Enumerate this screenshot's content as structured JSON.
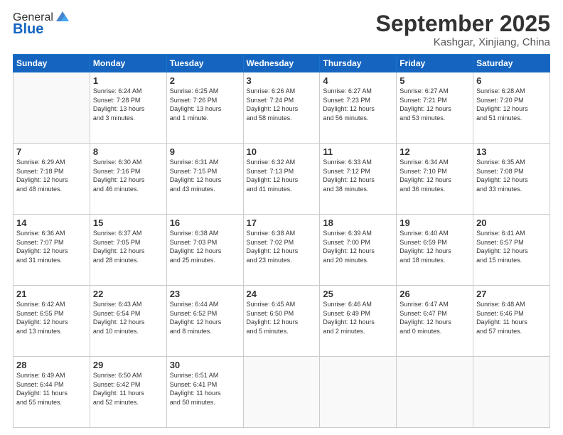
{
  "header": {
    "logo_general": "General",
    "logo_blue": "Blue",
    "month_title": "September 2025",
    "location": "Kashgar, Xinjiang, China"
  },
  "weekdays": [
    "Sunday",
    "Monday",
    "Tuesday",
    "Wednesday",
    "Thursday",
    "Friday",
    "Saturday"
  ],
  "weeks": [
    [
      {
        "day": "",
        "info": ""
      },
      {
        "day": "1",
        "info": "Sunrise: 6:24 AM\nSunset: 7:28 PM\nDaylight: 13 hours\nand 3 minutes."
      },
      {
        "day": "2",
        "info": "Sunrise: 6:25 AM\nSunset: 7:26 PM\nDaylight: 13 hours\nand 1 minute."
      },
      {
        "day": "3",
        "info": "Sunrise: 6:26 AM\nSunset: 7:24 PM\nDaylight: 12 hours\nand 58 minutes."
      },
      {
        "day": "4",
        "info": "Sunrise: 6:27 AM\nSunset: 7:23 PM\nDaylight: 12 hours\nand 56 minutes."
      },
      {
        "day": "5",
        "info": "Sunrise: 6:27 AM\nSunset: 7:21 PM\nDaylight: 12 hours\nand 53 minutes."
      },
      {
        "day": "6",
        "info": "Sunrise: 6:28 AM\nSunset: 7:20 PM\nDaylight: 12 hours\nand 51 minutes."
      }
    ],
    [
      {
        "day": "7",
        "info": "Sunrise: 6:29 AM\nSunset: 7:18 PM\nDaylight: 12 hours\nand 48 minutes."
      },
      {
        "day": "8",
        "info": "Sunrise: 6:30 AM\nSunset: 7:16 PM\nDaylight: 12 hours\nand 46 minutes."
      },
      {
        "day": "9",
        "info": "Sunrise: 6:31 AM\nSunset: 7:15 PM\nDaylight: 12 hours\nand 43 minutes."
      },
      {
        "day": "10",
        "info": "Sunrise: 6:32 AM\nSunset: 7:13 PM\nDaylight: 12 hours\nand 41 minutes."
      },
      {
        "day": "11",
        "info": "Sunrise: 6:33 AM\nSunset: 7:12 PM\nDaylight: 12 hours\nand 38 minutes."
      },
      {
        "day": "12",
        "info": "Sunrise: 6:34 AM\nSunset: 7:10 PM\nDaylight: 12 hours\nand 36 minutes."
      },
      {
        "day": "13",
        "info": "Sunrise: 6:35 AM\nSunset: 7:08 PM\nDaylight: 12 hours\nand 33 minutes."
      }
    ],
    [
      {
        "day": "14",
        "info": "Sunrise: 6:36 AM\nSunset: 7:07 PM\nDaylight: 12 hours\nand 31 minutes."
      },
      {
        "day": "15",
        "info": "Sunrise: 6:37 AM\nSunset: 7:05 PM\nDaylight: 12 hours\nand 28 minutes."
      },
      {
        "day": "16",
        "info": "Sunrise: 6:38 AM\nSunset: 7:03 PM\nDaylight: 12 hours\nand 25 minutes."
      },
      {
        "day": "17",
        "info": "Sunrise: 6:38 AM\nSunset: 7:02 PM\nDaylight: 12 hours\nand 23 minutes."
      },
      {
        "day": "18",
        "info": "Sunrise: 6:39 AM\nSunset: 7:00 PM\nDaylight: 12 hours\nand 20 minutes."
      },
      {
        "day": "19",
        "info": "Sunrise: 6:40 AM\nSunset: 6:59 PM\nDaylight: 12 hours\nand 18 minutes."
      },
      {
        "day": "20",
        "info": "Sunrise: 6:41 AM\nSunset: 6:57 PM\nDaylight: 12 hours\nand 15 minutes."
      }
    ],
    [
      {
        "day": "21",
        "info": "Sunrise: 6:42 AM\nSunset: 6:55 PM\nDaylight: 12 hours\nand 13 minutes."
      },
      {
        "day": "22",
        "info": "Sunrise: 6:43 AM\nSunset: 6:54 PM\nDaylight: 12 hours\nand 10 minutes."
      },
      {
        "day": "23",
        "info": "Sunrise: 6:44 AM\nSunset: 6:52 PM\nDaylight: 12 hours\nand 8 minutes."
      },
      {
        "day": "24",
        "info": "Sunrise: 6:45 AM\nSunset: 6:50 PM\nDaylight: 12 hours\nand 5 minutes."
      },
      {
        "day": "25",
        "info": "Sunrise: 6:46 AM\nSunset: 6:49 PM\nDaylight: 12 hours\nand 2 minutes."
      },
      {
        "day": "26",
        "info": "Sunrise: 6:47 AM\nSunset: 6:47 PM\nDaylight: 12 hours\nand 0 minutes."
      },
      {
        "day": "27",
        "info": "Sunrise: 6:48 AM\nSunset: 6:46 PM\nDaylight: 11 hours\nand 57 minutes."
      }
    ],
    [
      {
        "day": "28",
        "info": "Sunrise: 6:49 AM\nSunset: 6:44 PM\nDaylight: 11 hours\nand 55 minutes."
      },
      {
        "day": "29",
        "info": "Sunrise: 6:50 AM\nSunset: 6:42 PM\nDaylight: 11 hours\nand 52 minutes."
      },
      {
        "day": "30",
        "info": "Sunrise: 6:51 AM\nSunset: 6:41 PM\nDaylight: 11 hours\nand 50 minutes."
      },
      {
        "day": "",
        "info": ""
      },
      {
        "day": "",
        "info": ""
      },
      {
        "day": "",
        "info": ""
      },
      {
        "day": "",
        "info": ""
      }
    ]
  ]
}
